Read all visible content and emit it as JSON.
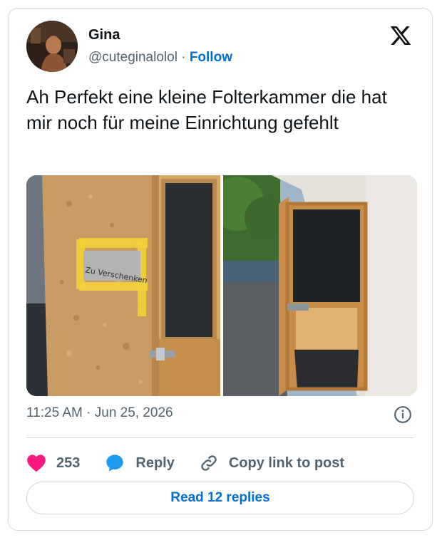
{
  "author": {
    "name": "Gina",
    "handle": "@cuteginalolol",
    "separator": "·",
    "follow_label": "Follow"
  },
  "brand_logo": "x-logo-icon",
  "tweet": {
    "text": "Ah Perfekt eine kleine Folterkammer die hat mir noch für meine Einrichtung gefehlt",
    "timestamp": "11:25 AM · Jun 25, 2026"
  },
  "media": {
    "photo_1_sign": "Zu Verschenken"
  },
  "actions": {
    "like_count": "253",
    "reply_label": "Reply",
    "copy_label": "Copy link to post"
  },
  "read_replies_label": "Read 12 replies",
  "colors": {
    "accent": "#006fd6",
    "like": "#f91880",
    "reply_bubble": "#1d9bf0",
    "muted": "#536471",
    "border": "#cfd9de"
  }
}
